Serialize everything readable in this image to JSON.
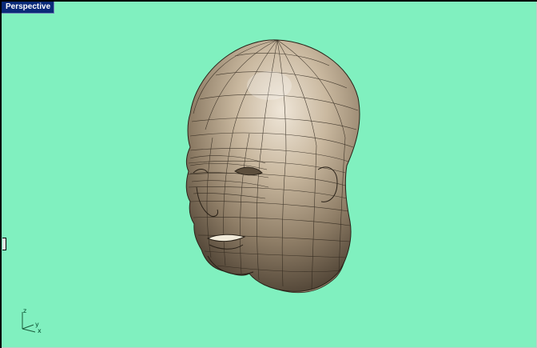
{
  "viewport": {
    "title": "Perspective",
    "background_color": "#80f0bf",
    "title_bar_color": "#0a2a78",
    "model_color": "#b49f86"
  },
  "axis_gizmo": {
    "z_label": "z",
    "y_label": "y",
    "x_label": "x"
  }
}
